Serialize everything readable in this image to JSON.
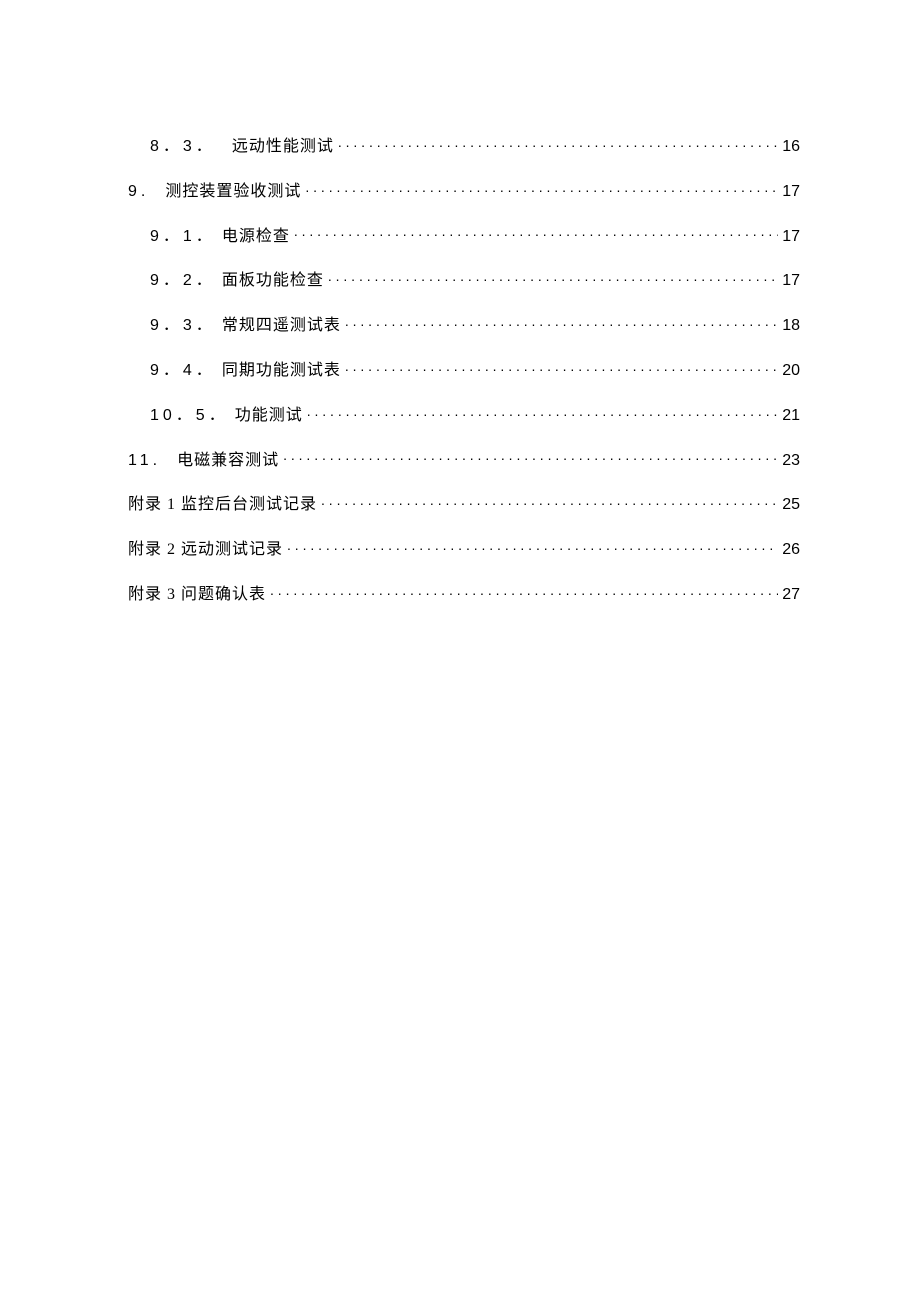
{
  "toc": [
    {
      "indent": 2,
      "num": "8．3．",
      "title": "远动性能测试",
      "page": "16",
      "gap": "wide"
    },
    {
      "indent": 0,
      "num": "9.",
      "title": "测控装置验收测试",
      "page": "17",
      "gap": "wide"
    },
    {
      "indent": 1,
      "num": "9．1．",
      "title": "电源检查",
      "page": "17",
      "gap": "norm"
    },
    {
      "indent": 1,
      "num": "9．2．",
      "title": "面板功能检查",
      "page": "17",
      "gap": "norm"
    },
    {
      "indent": 1,
      "num": "9．3．",
      "title": "常规四遥测试表",
      "page": "18",
      "gap": "norm"
    },
    {
      "indent": 1,
      "num": "9．4．",
      "title": "同期功能测试表",
      "page": "20",
      "gap": "norm"
    },
    {
      "indent": 1,
      "num": "10．5．",
      "title": "功能测试",
      "page": "21",
      "gap": "norm"
    },
    {
      "indent": 0,
      "num": "11.",
      "title": "电磁兼容测试",
      "page": "23",
      "gap": "wide"
    },
    {
      "indent": 0,
      "num": "",
      "title": "附录 1 监控后台测试记录",
      "page": "25",
      "gap": "none"
    },
    {
      "indent": 0,
      "num": "",
      "title": "附录 2 远动测试记录",
      "page": "26",
      "gap": "none"
    },
    {
      "indent": 0,
      "num": "",
      "title": "附录 3 问题确认表",
      "page": "27",
      "gap": "none"
    }
  ]
}
